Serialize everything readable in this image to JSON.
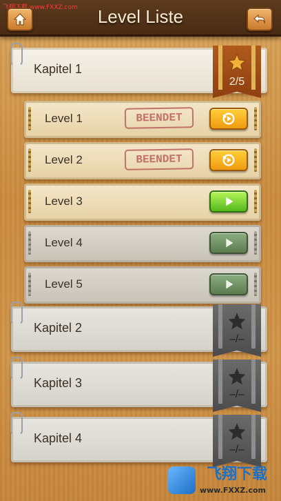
{
  "watermark": {
    "top_text": "飞翔下载 www.FXXZ.com",
    "bottom_brand": "飞翔下载",
    "bottom_url": "www.FXXZ.com"
  },
  "header": {
    "title": "Level Liste",
    "home_icon": "home-icon",
    "back_icon": "back-arrow-icon"
  },
  "colors": {
    "accent_orange": "#f09a10",
    "play_green": "#54b91c",
    "ribbon_brown": "#8e3f10",
    "stamp_red": "#b9605a"
  },
  "chapters": [
    {
      "label": "Kapitel 1",
      "score": "2/5",
      "locked": false
    },
    {
      "label": "Kapitel 2",
      "score": "–/–",
      "locked": true
    },
    {
      "label": "Kapitel 3",
      "score": "–/–",
      "locked": true
    },
    {
      "label": "Kapitel 4",
      "score": "–/–",
      "locked": true
    }
  ],
  "levels": [
    {
      "label": "Level 1",
      "stamp": "BEENDET",
      "button": "replay"
    },
    {
      "label": "Level 2",
      "stamp": "BEENDET",
      "button": "replay"
    },
    {
      "label": "Level 3",
      "stamp": "",
      "button": "play"
    },
    {
      "label": "Level 4",
      "stamp": "",
      "button": "play-disabled"
    },
    {
      "label": "Level 5",
      "stamp": "",
      "button": "play-disabled"
    }
  ]
}
